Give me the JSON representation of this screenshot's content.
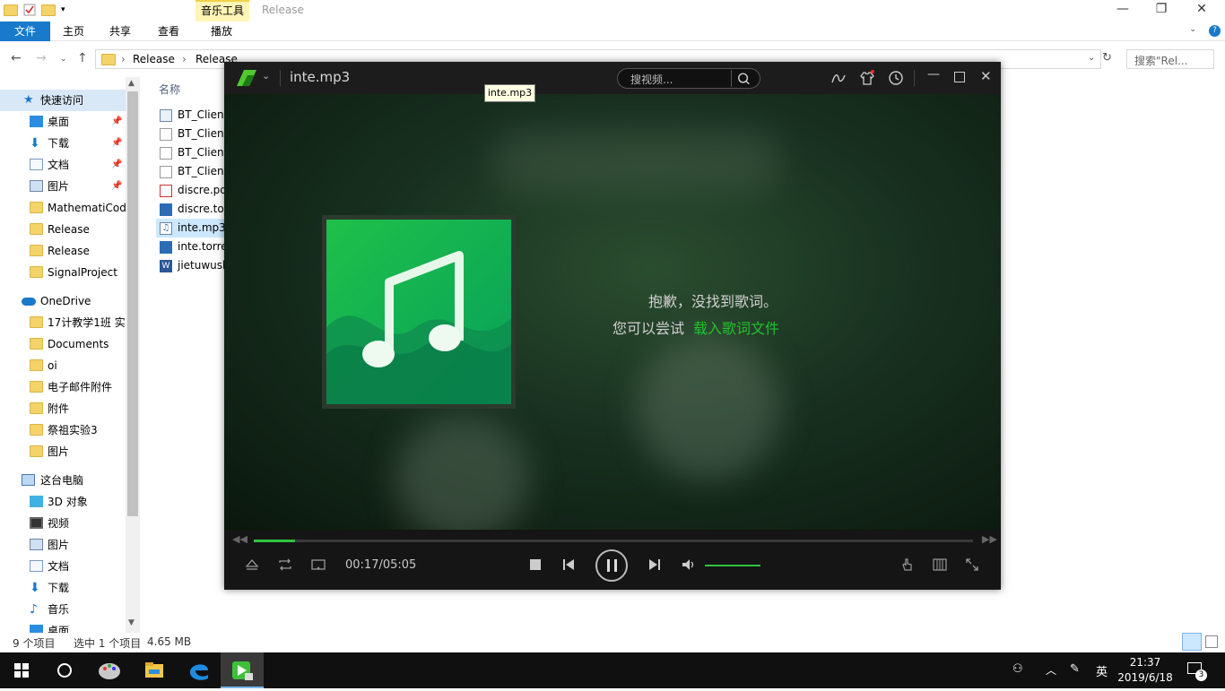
{
  "explorer": {
    "ribbon": {
      "context_tab": "音乐工具",
      "window_title": "Release",
      "tabs": [
        "文件",
        "主页",
        "共享",
        "查看",
        "播放"
      ]
    },
    "address": {
      "crumbs": [
        "Release",
        "Release"
      ],
      "search_placeholder": "搜索\"Rel..."
    },
    "nav_pane": {
      "quick_access": "快速访问",
      "quick_items": [
        "桌面",
        "下载",
        "文档",
        "图片",
        "MathematiCod",
        "Release",
        "Release",
        "SignalProject"
      ],
      "onedrive": "OneDrive",
      "onedrive_items": [
        "17计教学1班 实",
        "Documents",
        "oi",
        "电子邮件附件",
        "附件",
        "祭祖实验3",
        "图片"
      ],
      "this_pc": "这台电脑",
      "pc_items": [
        "3D 对象",
        "视频",
        "图片",
        "文档",
        "下载",
        "音乐",
        "桌面"
      ]
    },
    "files": {
      "column_name": "名称",
      "items": [
        "BT_Client",
        "BT_Client",
        "BT_Client",
        "BT_Client",
        "discre.pd",
        "discre.tor",
        "inte.mp3",
        "inte.torre",
        "jietuwush"
      ]
    },
    "status": {
      "count": "9 个项目",
      "selected": "选中 1 个项目",
      "size": "4.65 MB"
    }
  },
  "player": {
    "title": "inte.mp3",
    "search_placeholder": "搜视频...",
    "tooltip": "inte.mp3",
    "lyric_sorry": "抱歉，没找到歌词。",
    "lyric_try": "您可以尝试",
    "lyric_link": "载入歌词文件",
    "time": "00:17/05:05",
    "progress": 0.057,
    "volume": 1.0,
    "accent_color": "#2ec440"
  },
  "taskbar": {
    "tray_lang": "英",
    "clock_time": "21:37",
    "clock_date": "2019/6/18",
    "notification_count": "3"
  }
}
